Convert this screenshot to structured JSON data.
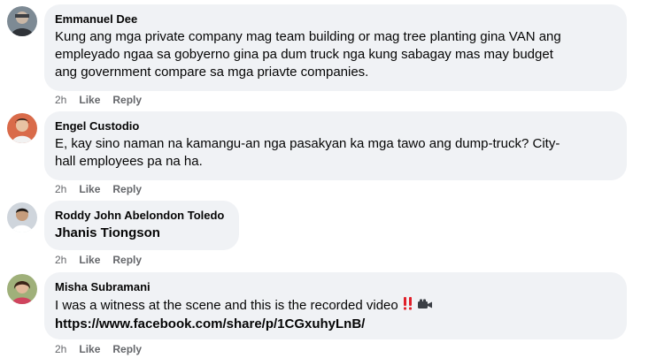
{
  "comments": [
    {
      "author": "Emmanuel Dee",
      "avatar_icon": "avatar-photo-icon",
      "lines": [
        "Kung ang mga private company mag team building or mag tree planting gina VAN ang",
        "empleyado ngaa sa gobyerno gina pa dum truck nga kung sabagay mas may budget",
        "ang government compare sa mga priavte companies."
      ],
      "time": "2h",
      "like": "Like",
      "reply": "Reply"
    },
    {
      "author": "Engel Custodio",
      "avatar_icon": "avatar-photo-icon",
      "lines": [
        "E, kay sino naman na kamangu-an nga pasakyan ka mga tawo ang dump-truck? City-",
        "hall employees pa na ha."
      ],
      "time": "2h",
      "like": "Like",
      "reply": "Reply"
    },
    {
      "author": "Roddy John Abelondon Toledo",
      "avatar_icon": "avatar-photo-icon",
      "tag": "Jhanis Tiongson",
      "time": "2h",
      "like": "Like",
      "reply": "Reply"
    },
    {
      "author": "Misha Subramani",
      "avatar_icon": "avatar-photo-icon",
      "text": "I was a witness at the scene and this is the recorded video",
      "emoji": [
        "double-exclamation-icon",
        "video-camera-icon"
      ],
      "link": "https://www.facebook.com/share/p/1CGxuhyLnB/",
      "time": "2h",
      "like": "Like",
      "reply": "Reply"
    }
  ],
  "colors": {
    "bubble": "#f0f2f5",
    "text": "#050505",
    "meta": "#65676b",
    "emoji_red": "#e0202a"
  }
}
